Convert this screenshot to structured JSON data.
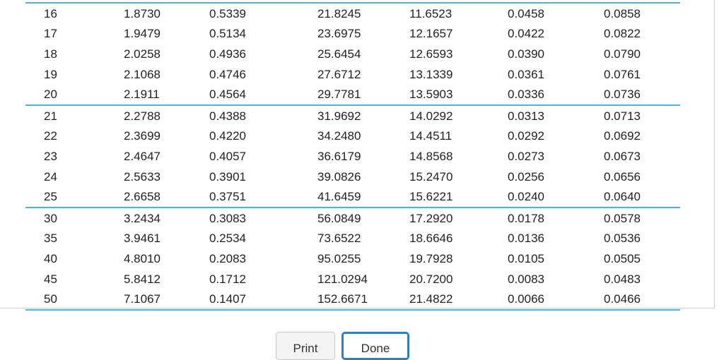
{
  "table": {
    "groups": [
      {
        "rows": [
          [
            "16",
            "1.8730",
            "0.5339",
            "21.8245",
            "11.6523",
            "0.0458",
            "0.0858"
          ],
          [
            "17",
            "1.9479",
            "0.5134",
            "23.6975",
            "12.1657",
            "0.0422",
            "0.0822"
          ],
          [
            "18",
            "2.0258",
            "0.4936",
            "25.6454",
            "12.6593",
            "0.0390",
            "0.0790"
          ],
          [
            "19",
            "2.1068",
            "0.4746",
            "27.6712",
            "13.1339",
            "0.0361",
            "0.0761"
          ],
          [
            "20",
            "2.1911",
            "0.4564",
            "29.7781",
            "13.5903",
            "0.0336",
            "0.0736"
          ]
        ]
      },
      {
        "rows": [
          [
            "21",
            "2.2788",
            "0.4388",
            "31.9692",
            "14.0292",
            "0.0313",
            "0.0713"
          ],
          [
            "22",
            "2.3699",
            "0.4220",
            "34.2480",
            "14.4511",
            "0.0292",
            "0.0692"
          ],
          [
            "23",
            "2.4647",
            "0.4057",
            "36.6179",
            "14.8568",
            "0.0273",
            "0.0673"
          ],
          [
            "24",
            "2.5633",
            "0.3901",
            "39.0826",
            "15.2470",
            "0.0256",
            "0.0656"
          ],
          [
            "25",
            "2.6658",
            "0.3751",
            "41.6459",
            "15.6221",
            "0.0240",
            "0.0640"
          ]
        ]
      },
      {
        "rows": [
          [
            "30",
            "3.2434",
            "0.3083",
            "56.0849",
            "17.2920",
            "0.0178",
            "0.0578"
          ],
          [
            "35",
            "3.9461",
            "0.2534",
            "73.6522",
            "18.6646",
            "0.0136",
            "0.0536"
          ],
          [
            "40",
            "4.8010",
            "0.2083",
            "95.0255",
            "19.7928",
            "0.0105",
            "0.0505"
          ],
          [
            "45",
            "5.8412",
            "0.1712",
            "121.0294",
            "20.7200",
            "0.0083",
            "0.0483"
          ],
          [
            "50",
            "7.1067",
            "0.1407",
            "152.6671",
            "21.4822",
            "0.0066",
            "0.0466"
          ]
        ]
      }
    ]
  },
  "buttons": {
    "print_label": "Print",
    "done_label": "Done"
  },
  "colors": {
    "separator": "#4fb3e0",
    "done_border": "#2a7fc9"
  }
}
